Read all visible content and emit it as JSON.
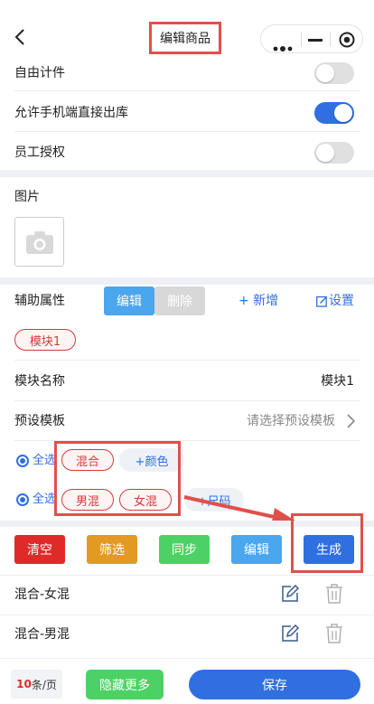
{
  "header": {
    "title": "编辑商品"
  },
  "toggles": [
    {
      "label": "自由计件",
      "on": false
    },
    {
      "label": "允许手机端直接出库",
      "on": true
    },
    {
      "label": "员工授权",
      "on": false
    }
  ],
  "image_section": {
    "label": "图片"
  },
  "aux": {
    "label": "辅助属性",
    "edit": "编辑",
    "delete": "删除",
    "add": "+ 新增",
    "settings": "设置",
    "module_chip": "模块1",
    "module_name_label": "模块名称",
    "module_name_value": "模块1",
    "preset_label": "预设模板",
    "preset_placeholder": "请选择预设模板"
  },
  "attr_rows": [
    {
      "select_all": "全选",
      "chips": [
        "混合"
      ],
      "add": "+颜色"
    },
    {
      "select_all": "全选",
      "chips": [
        "男混",
        "女混"
      ],
      "add": "+尺码"
    }
  ],
  "actions": {
    "clear": "清空",
    "filter": "筛选",
    "sync": "同步",
    "edit": "编辑",
    "generate": "生成"
  },
  "sku_rows": [
    {
      "name": "混合-女混"
    },
    {
      "name": "混合-男混"
    }
  ],
  "footer": {
    "page_count": "10",
    "page_unit": "条/页",
    "hide_more": "隐藏更多",
    "save": "保存"
  },
  "colors": {
    "primary": "#2f6fe0",
    "red": "#e02a2a",
    "orange": "#e39a24",
    "green": "#4cd264",
    "light_blue": "#4aa6ee"
  }
}
